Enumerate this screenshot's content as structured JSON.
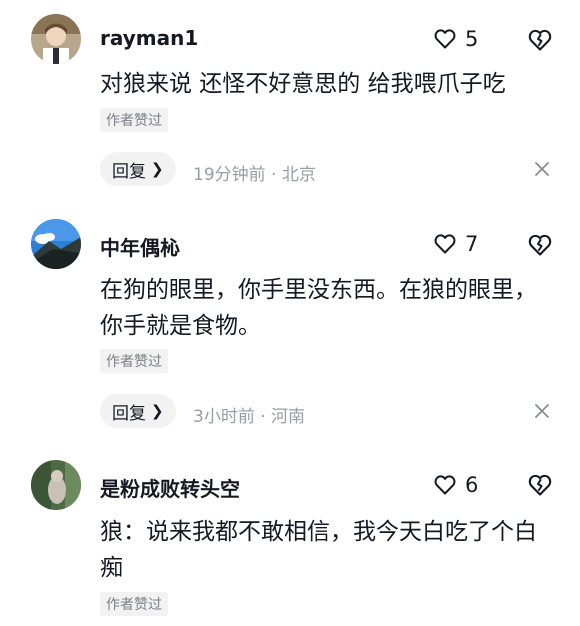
{
  "comments": [
    {
      "username": "rayman1",
      "likes": "5",
      "text": "对狼来说 还怪不好意思的 给我喂爪子吃",
      "badge": "作者赞过",
      "reply_label": "回复",
      "meta": "19分钟前 · 北京"
    },
    {
      "username": "中年偶杺",
      "likes": "7",
      "text": "在狗的眼里，你手里没东西。在狼的眼里，你手就是食物。",
      "badge": "作者赞过",
      "reply_label": "回复",
      "meta": "3小时前 · 河南"
    },
    {
      "username": "是粉成败转头空",
      "likes": "6",
      "text": "狼：说来我都不敢相信，我今天白吃了个白痴",
      "badge": "作者赞过"
    }
  ]
}
